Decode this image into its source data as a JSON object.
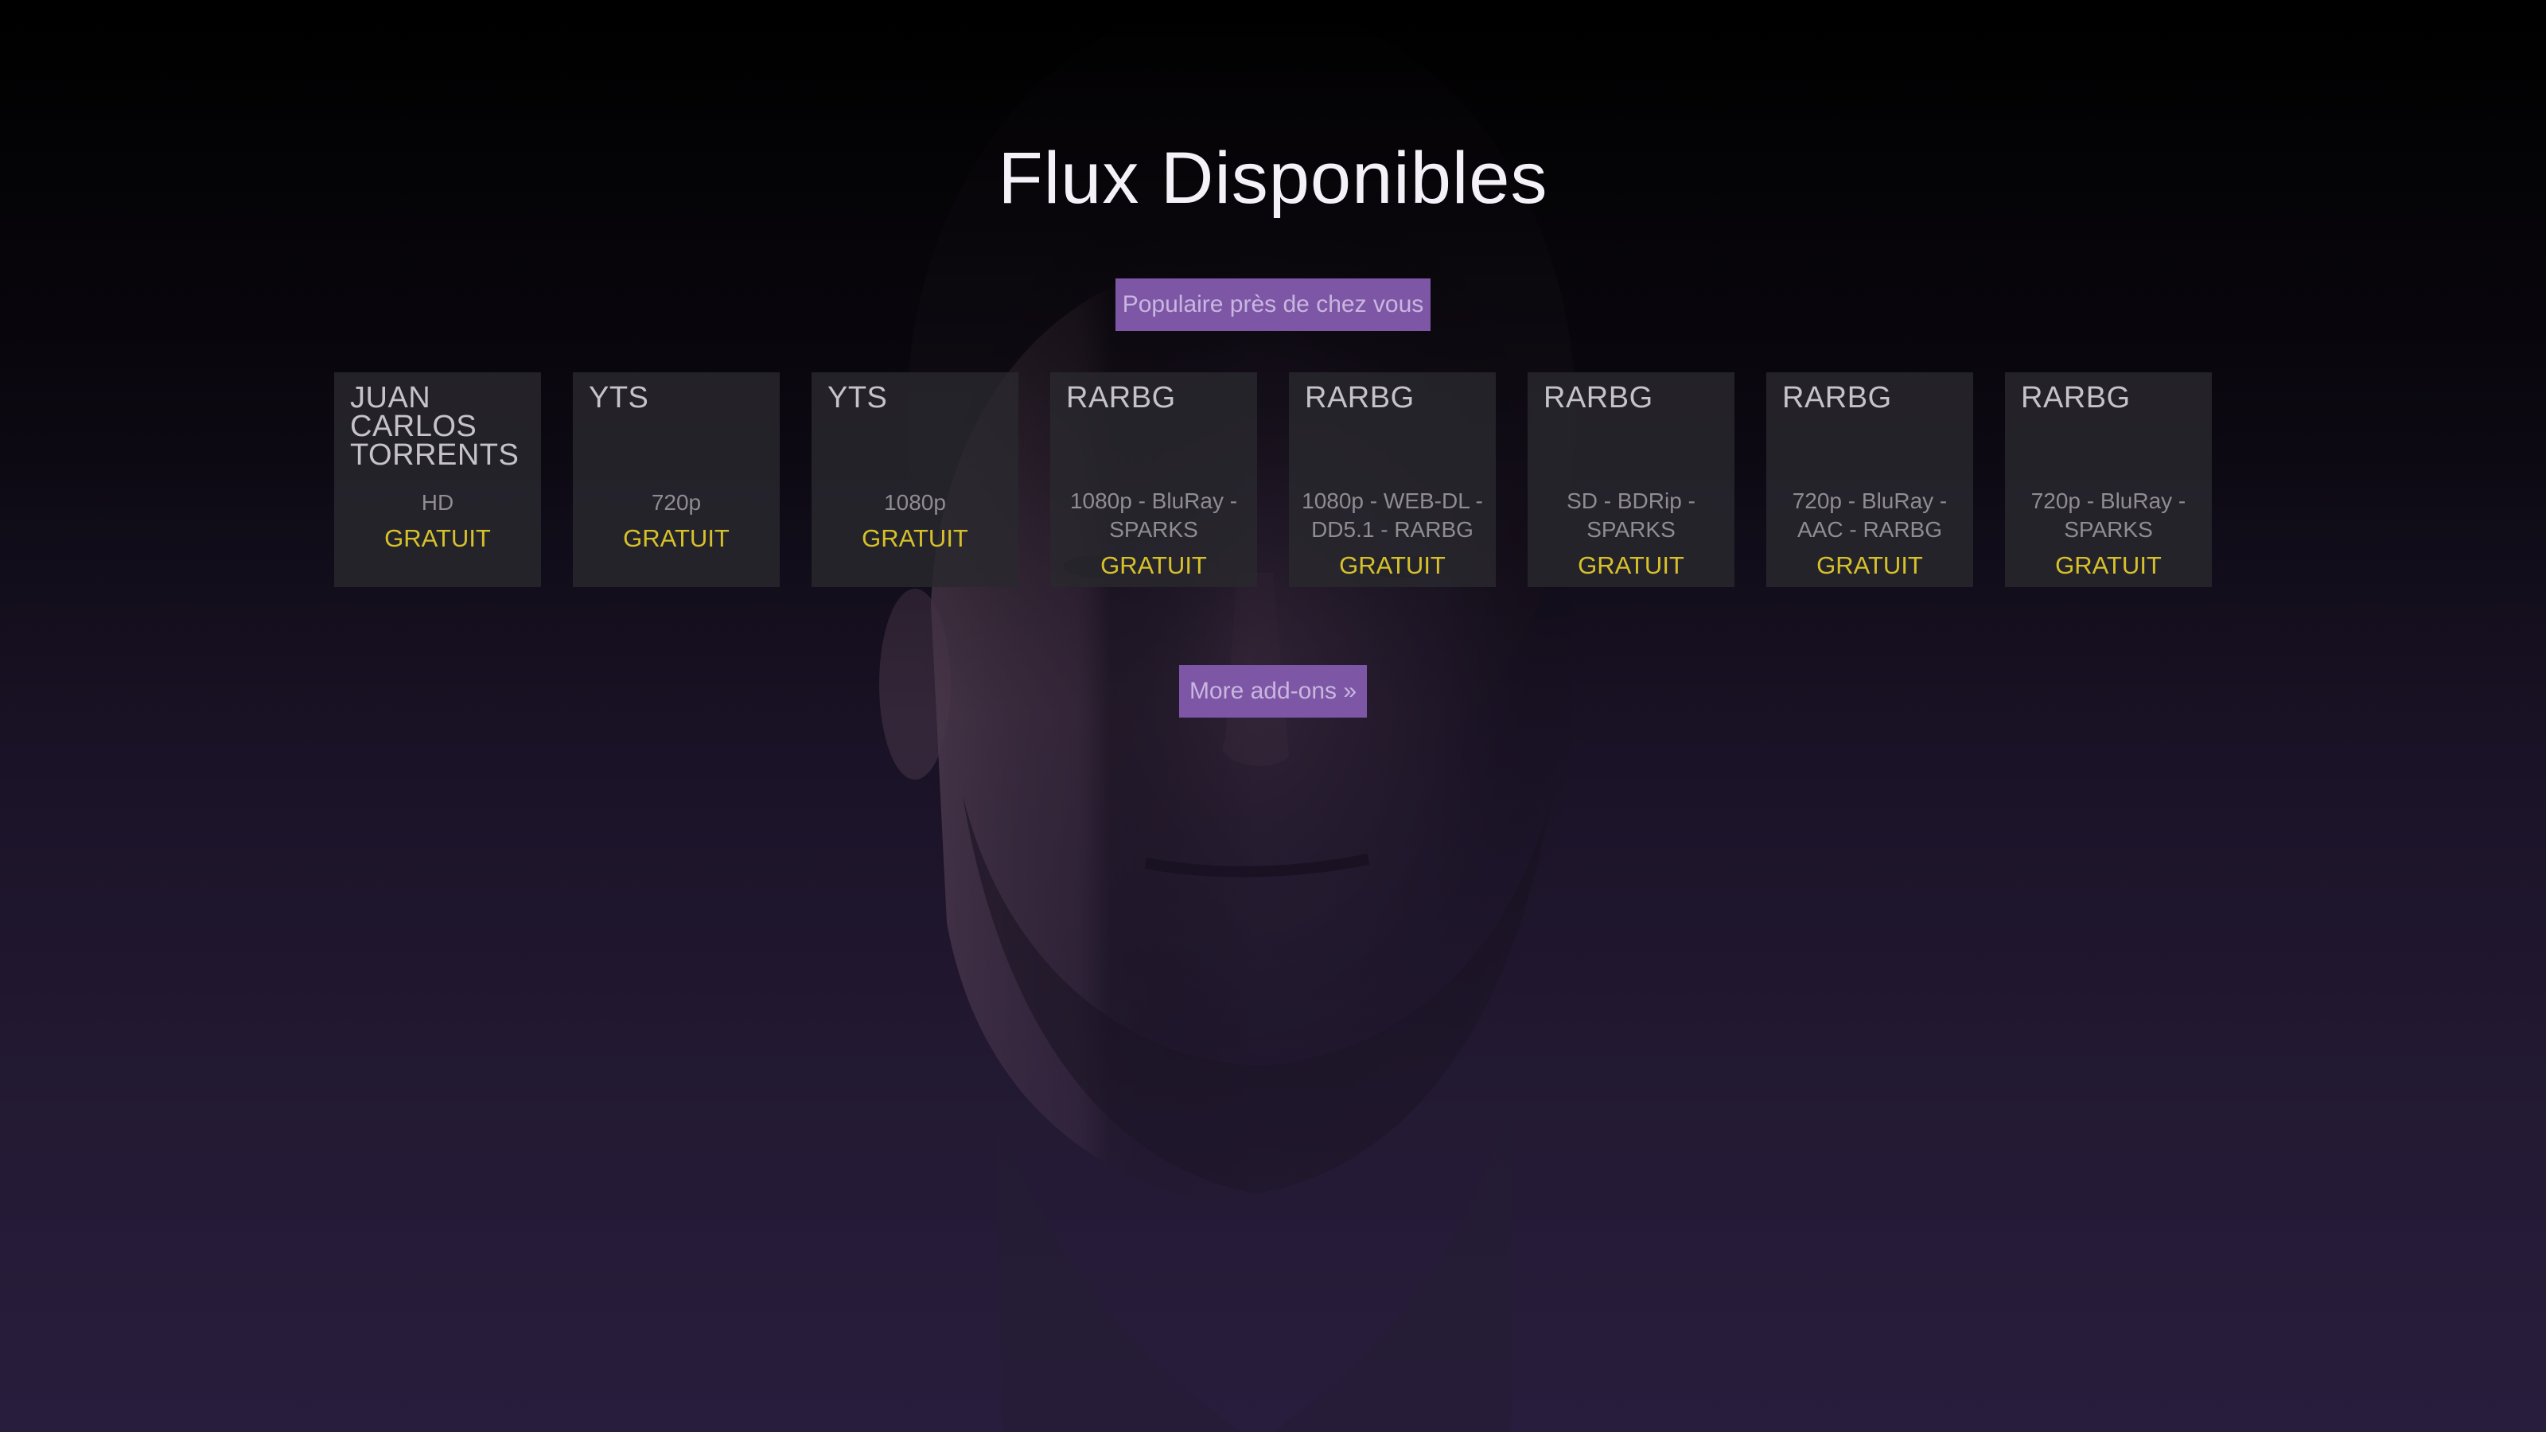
{
  "page": {
    "title": "Flux Disponibles"
  },
  "buttons": {
    "popular_label": "Populaire près de chez vous",
    "more_label": "More add-ons »"
  },
  "streams": [
    {
      "source": "JUAN CARLOS TORRENTS",
      "quality": "HD",
      "price": "GRATUIT"
    },
    {
      "source": "YTS",
      "quality": "720p",
      "price": "GRATUIT"
    },
    {
      "source": "YTS",
      "quality": "1080p",
      "price": "GRATUIT"
    },
    {
      "source": "RARBG",
      "quality": "1080p - BluRay - SPARKS",
      "price": "GRATUIT"
    },
    {
      "source": "RARBG",
      "quality": "1080p - WEB-DL - DD5.1 - RARBG",
      "price": "GRATUIT"
    },
    {
      "source": "RARBG",
      "quality": "SD - BDRip - SPARKS",
      "price": "GRATUIT"
    },
    {
      "source": "RARBG",
      "quality": "720p - BluRay - AAC - RARBG",
      "price": "GRATUIT"
    },
    {
      "source": "RARBG",
      "quality": "720p - BluRay - SPARKS",
      "price": "GRATUIT"
    }
  ],
  "colors": {
    "accent": "#7d57a6",
    "price": "#d7c12a",
    "card_bg": "#2a282e"
  }
}
